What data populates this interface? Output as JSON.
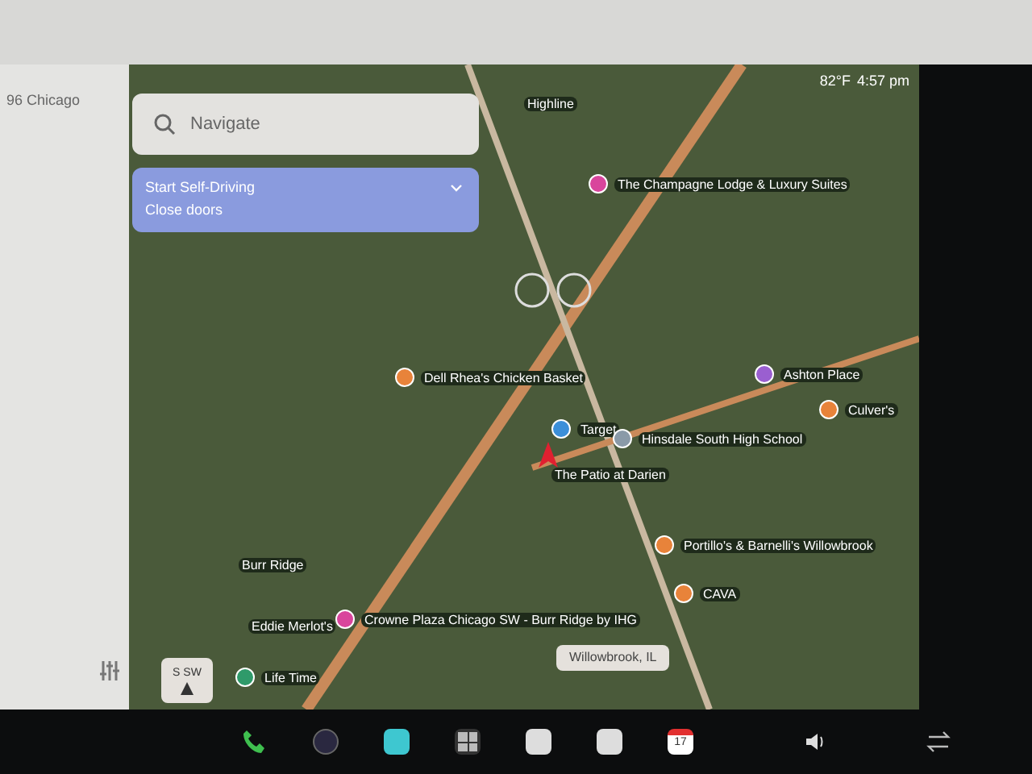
{
  "left_panel": {
    "location": "96 Chicago"
  },
  "search": {
    "placeholder": "Navigate"
  },
  "self_driving": {
    "title": "Start Self-Driving",
    "subtitle": "Close doors"
  },
  "status": {
    "temperature": "82°F",
    "time": "4:57 pm"
  },
  "map_labels": [
    {
      "text": "Highline",
      "kind": "area"
    },
    {
      "text": "The Champagne Lodge & Luxury Suites",
      "kind": "poi",
      "color": "#d9459c"
    },
    {
      "text": "Dell Rhea's Chicken Basket",
      "kind": "poi",
      "color": "#e8833a"
    },
    {
      "text": "Target",
      "kind": "poi",
      "color": "#3b8fd9"
    },
    {
      "text": "The Patio at Darien",
      "kind": "area"
    },
    {
      "text": "Ashton Place",
      "kind": "poi",
      "color": "#9a5fd0"
    },
    {
      "text": "Culver's",
      "kind": "poi",
      "color": "#e8833a"
    },
    {
      "text": "Hinsdale South High School",
      "kind": "poi",
      "color": "#8a9aa8"
    },
    {
      "text": "Portillo's & Barnelli's Willowbrook",
      "kind": "poi",
      "color": "#e8833a"
    },
    {
      "text": "CAVA",
      "kind": "poi",
      "color": "#e8833a"
    },
    {
      "text": "Crowne Plaza Chicago SW - Burr Ridge by IHG",
      "kind": "poi",
      "color": "#d9459c"
    },
    {
      "text": "Burr Ridge",
      "kind": "area"
    },
    {
      "text": "Eddie Merlot's",
      "kind": "area"
    },
    {
      "text": "Life Time",
      "kind": "poi",
      "color": "#2f9a6a"
    }
  ],
  "location_chip": "Willowbrook, IL",
  "compass": "S SW",
  "dock": {
    "calendar_day": "17"
  }
}
